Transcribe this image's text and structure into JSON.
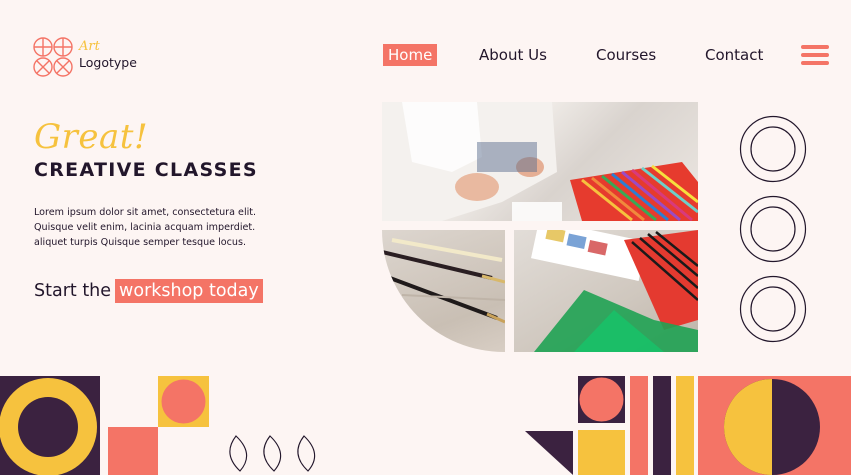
{
  "brand": {
    "script_text": "Art",
    "name": "Logotype",
    "icon": "geometric-circles-logo-icon"
  },
  "nav": {
    "items": [
      {
        "label": "Home",
        "active": true
      },
      {
        "label": "About Us",
        "active": false
      },
      {
        "label": "Courses",
        "active": false
      },
      {
        "label": "Contact",
        "active": false
      }
    ],
    "menu_icon": "hamburger-menu-icon"
  },
  "hero": {
    "eyebrow": "Great!",
    "headline": "CREATIVE CLASSES",
    "body_lines": [
      "Lorem ipsum dolor sit amet, consectetura elit.",
      "Quisque velit enim, lacinia acquam imperdiet.",
      "aliquet turpis Quisque semper tesque locus."
    ],
    "cta_prefix": "Start the",
    "cta_highlight": "workshop today"
  },
  "gallery": {
    "images": [
      {
        "subject": "person sorting art supplies"
      },
      {
        "subject": "paint brushes on table"
      },
      {
        "subject": "colored pencils and set squares"
      }
    ]
  },
  "colors": {
    "background": "#fdf5f3",
    "coral": "#f47466",
    "yellow": "#f6c23e",
    "dark_purple": "#3b2240",
    "text": "#22162b"
  }
}
